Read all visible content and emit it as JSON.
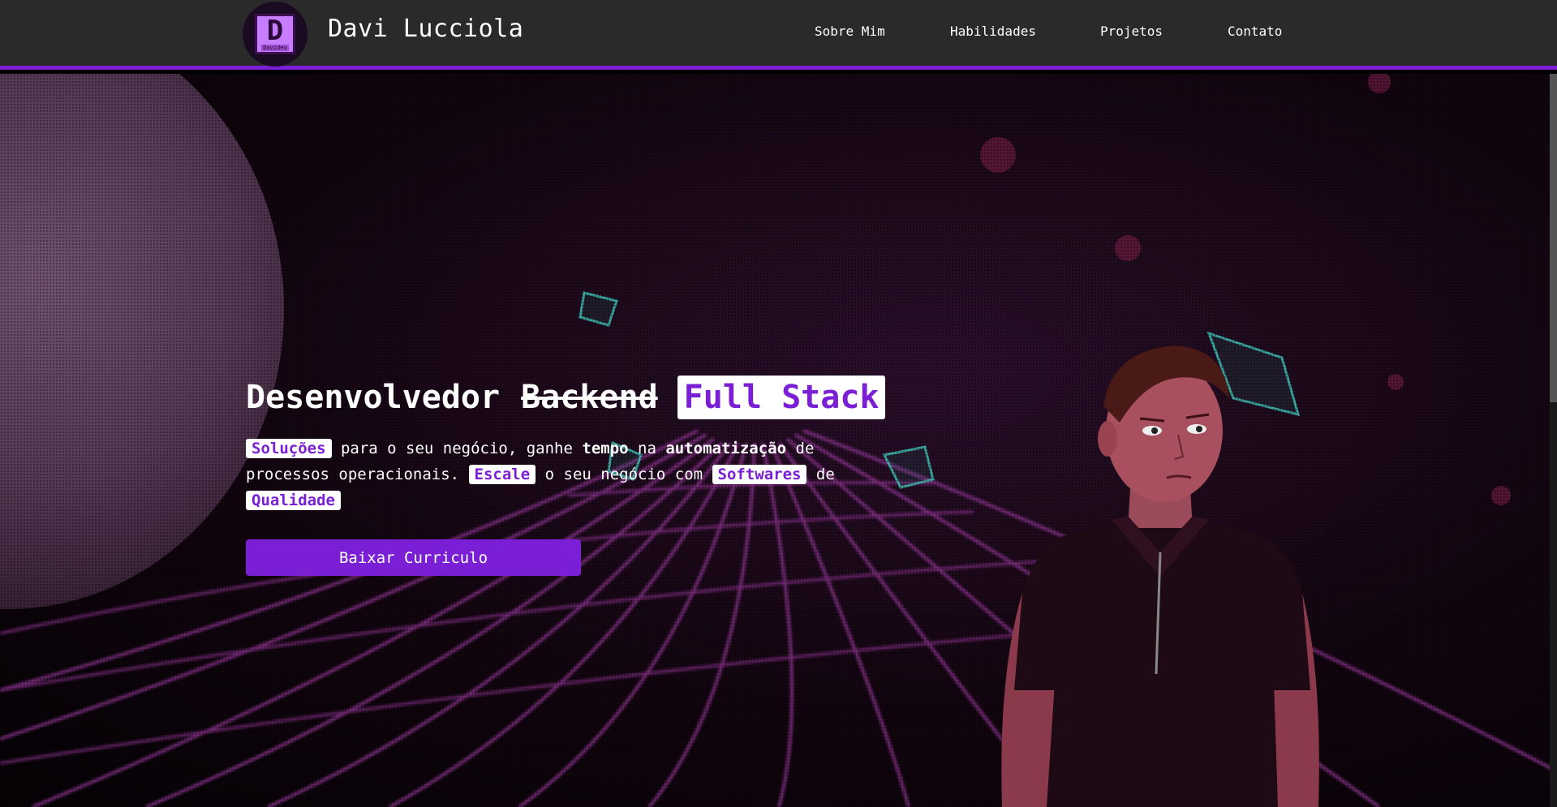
{
  "header": {
    "logo_letter": "D",
    "logo_sub": "Davidev",
    "title": "Davi Lucciola",
    "nav": [
      "Sobre Mim",
      "Habilidades",
      "Projetos",
      "Contato"
    ]
  },
  "hero": {
    "headline_prefix": "Desenvolvedor",
    "headline_strike": "Backend",
    "headline_badge": "Full Stack",
    "para": {
      "w1": "Soluções",
      "t1": " para o seu negócio, ganhe ",
      "b1": "tempo",
      "t2": " na ",
      "b2": "automatização",
      "t3": " de processos operacionais. ",
      "w2": "Escale",
      "t4": " o seu negócio com ",
      "w3": "Softwares",
      "t5": " de ",
      "w4": "Qualidade"
    },
    "cta_label": "Baixar Curriculo"
  },
  "colors": {
    "accent": "#7b1fd6",
    "header_bg": "#2a2a2a"
  },
  "icons": [
    "logo-icon",
    "character-illustration",
    "grid-background"
  ]
}
